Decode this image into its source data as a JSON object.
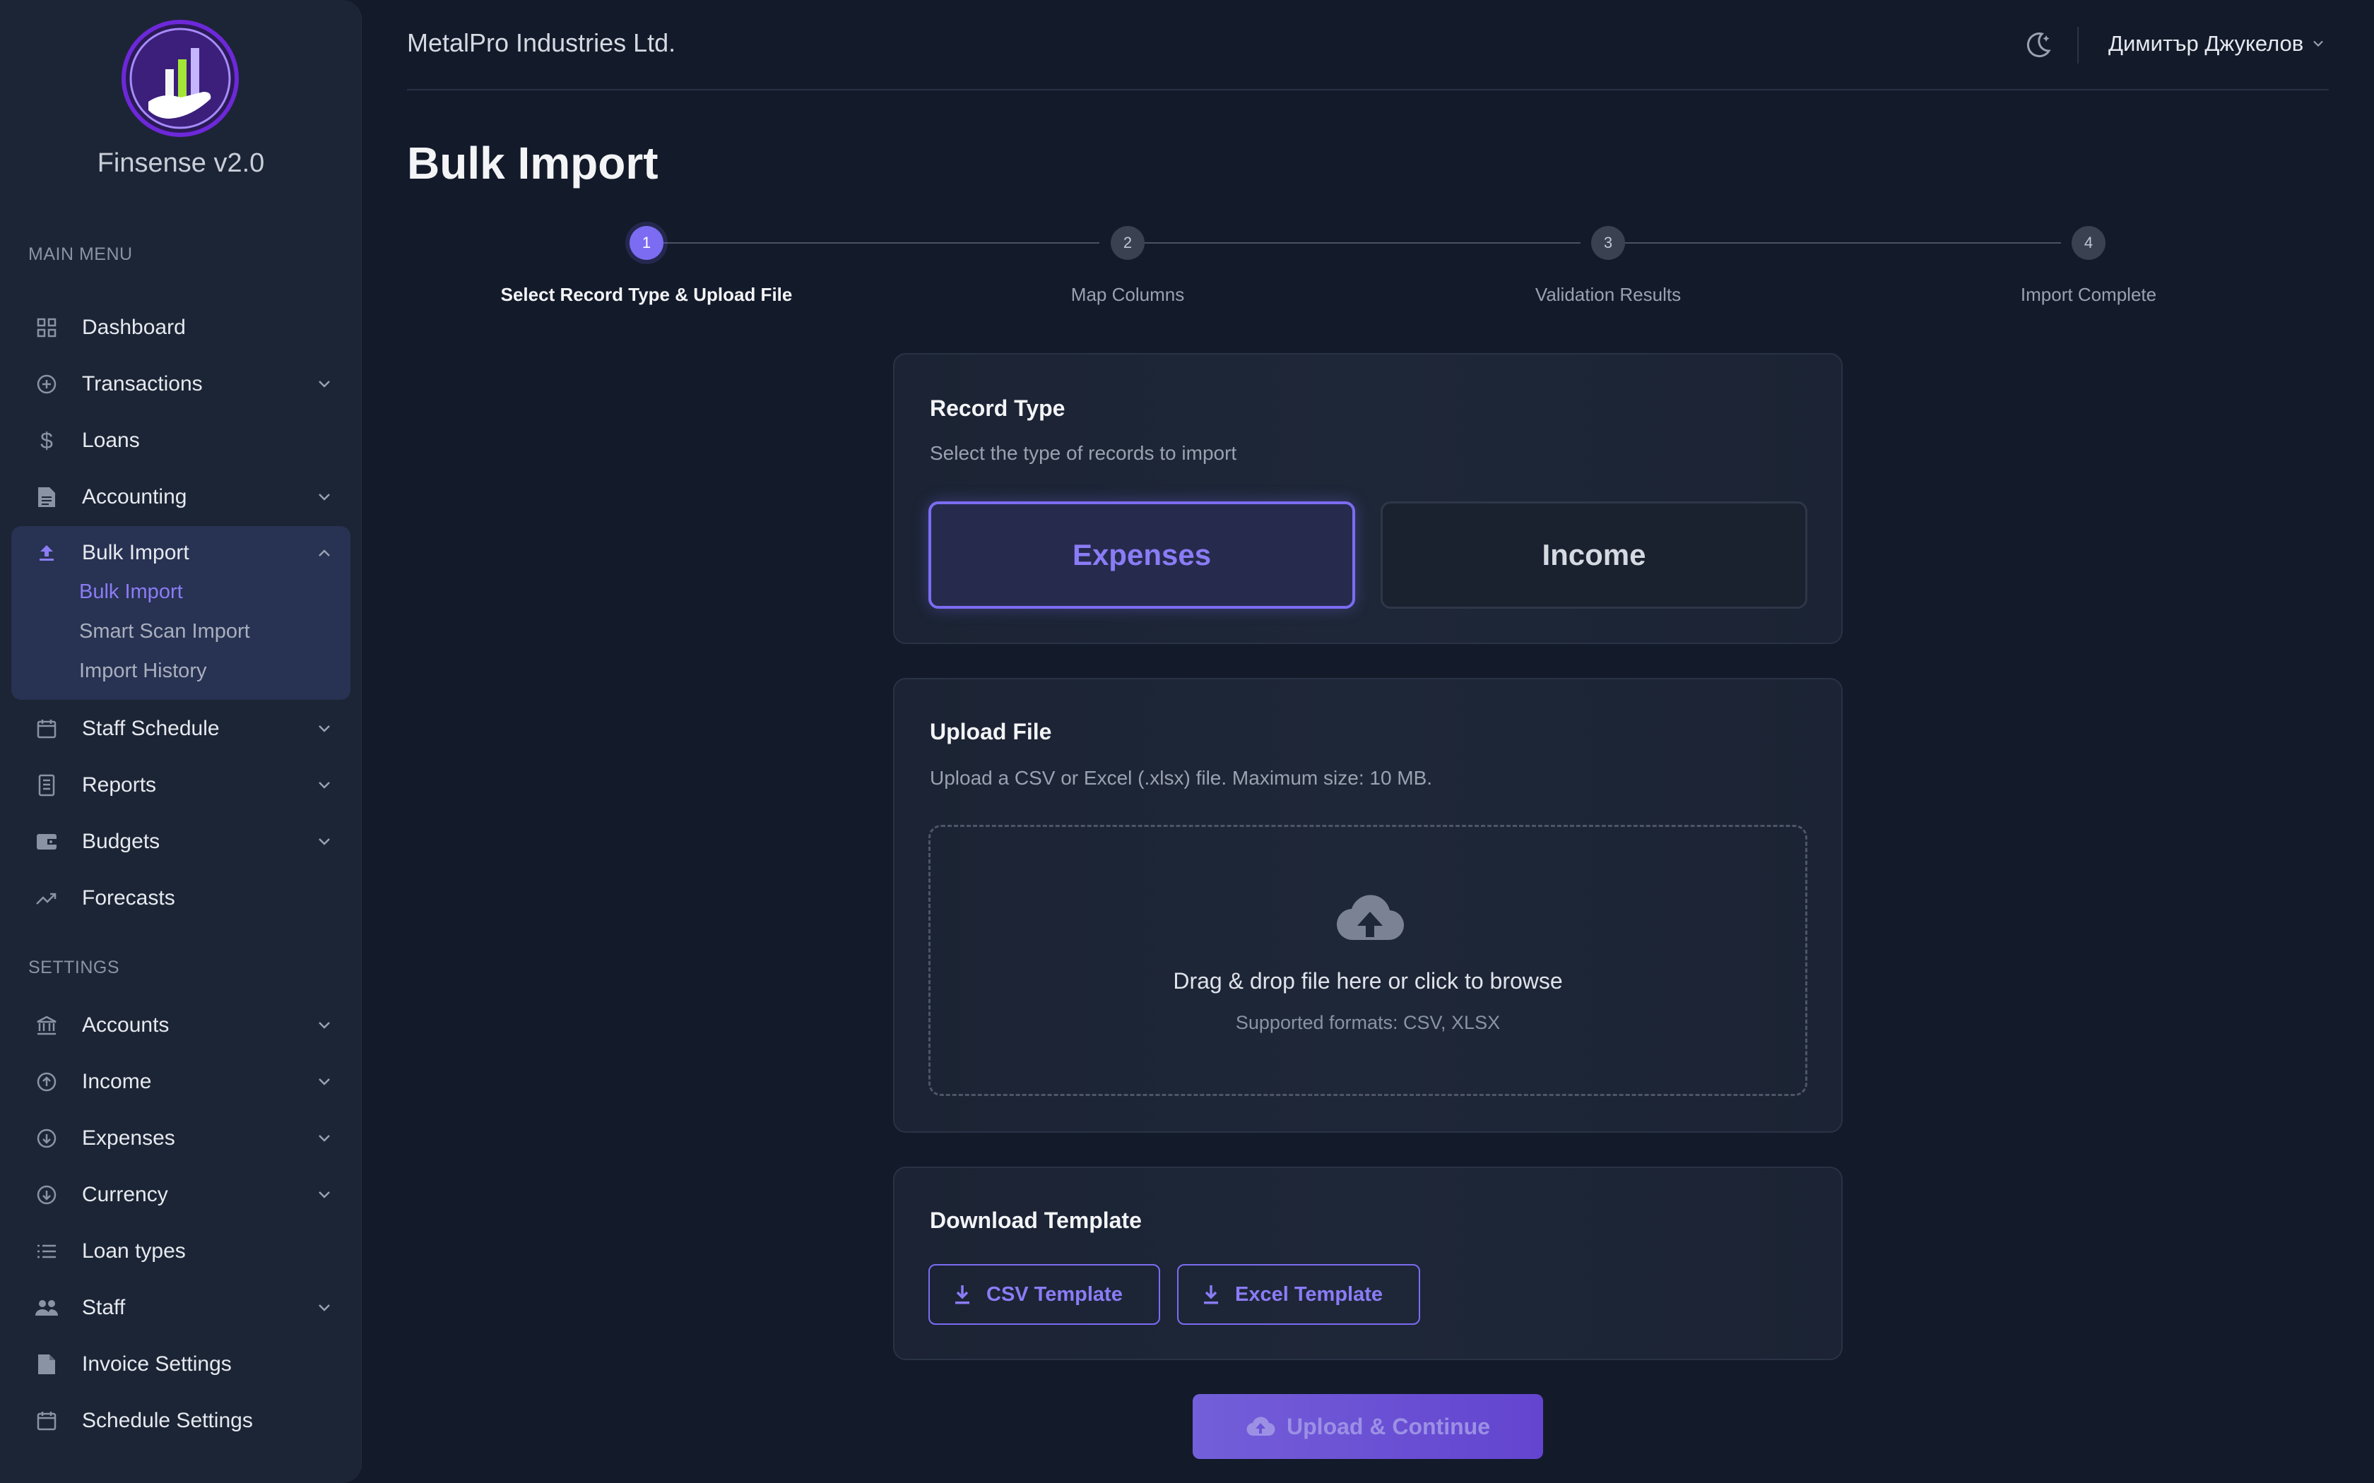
{
  "app": {
    "name": "Finsense v2.0"
  },
  "header": {
    "company": "MetalPro Industries Ltd.",
    "user_name": "Димитър Джукелов"
  },
  "sidebar": {
    "main_menu_label": "MAIN MENU",
    "main_items": [
      {
        "label": "Dashboard",
        "icon": "grid-icon"
      },
      {
        "label": "Transactions",
        "icon": "plus-circle-icon"
      },
      {
        "label": "Loans",
        "icon": "dollar-icon"
      },
      {
        "label": "Accounting",
        "icon": "document-icon"
      },
      {
        "label": "Bulk Import",
        "icon": "upload-icon",
        "expanded": true
      },
      {
        "label": "Staff Schedule",
        "icon": "calendar-icon"
      },
      {
        "label": "Reports",
        "icon": "report-icon"
      },
      {
        "label": "Budgets",
        "icon": "wallet-icon"
      },
      {
        "label": "Forecasts",
        "icon": "trend-icon"
      }
    ],
    "bulk_import_subitems": [
      {
        "label": "Bulk Import",
        "active": true
      },
      {
        "label": "Smart Scan Import"
      },
      {
        "label": "Import History"
      }
    ],
    "settings_label": "SETTINGS",
    "settings_items": [
      {
        "label": "Accounts",
        "icon": "bank-icon"
      },
      {
        "label": "Income",
        "icon": "arrow-up-circle-icon"
      },
      {
        "label": "Expenses",
        "icon": "arrow-down-circle-icon"
      },
      {
        "label": "Currency",
        "icon": "currency-icon"
      },
      {
        "label": "Loan types",
        "icon": "list-icon"
      },
      {
        "label": "Staff",
        "icon": "people-icon"
      },
      {
        "label": "Invoice Settings",
        "icon": "invoice-icon"
      },
      {
        "label": "Schedule Settings",
        "icon": "calendar-icon"
      }
    ]
  },
  "page": {
    "title": "Bulk Import"
  },
  "stepper": {
    "steps": [
      {
        "number": "1",
        "label": "Select Record Type & Upload File",
        "active": true
      },
      {
        "number": "2",
        "label": "Map Columns"
      },
      {
        "number": "3",
        "label": "Validation Results"
      },
      {
        "number": "4",
        "label": "Import Complete"
      }
    ]
  },
  "record_type": {
    "title": "Record Type",
    "subtitle": "Select the type of records to import",
    "options": [
      "Expenses",
      "Income"
    ],
    "selected": "Expenses"
  },
  "upload": {
    "title": "Upload File",
    "subtitle": "Upload a CSV or Excel (.xlsx) file. Maximum size: 10 MB.",
    "drop_text": "Drag & drop file here or click to browse",
    "formats_text": "Supported formats: CSV, XLSX"
  },
  "template": {
    "title": "Download Template",
    "csv_label": "CSV Template",
    "excel_label": "Excel Template"
  },
  "actions": {
    "upload_continue": "Upload & Continue"
  },
  "colors": {
    "accent": "#7c6cf2",
    "background": "#131a2a",
    "sidebar": "#1c2535"
  }
}
